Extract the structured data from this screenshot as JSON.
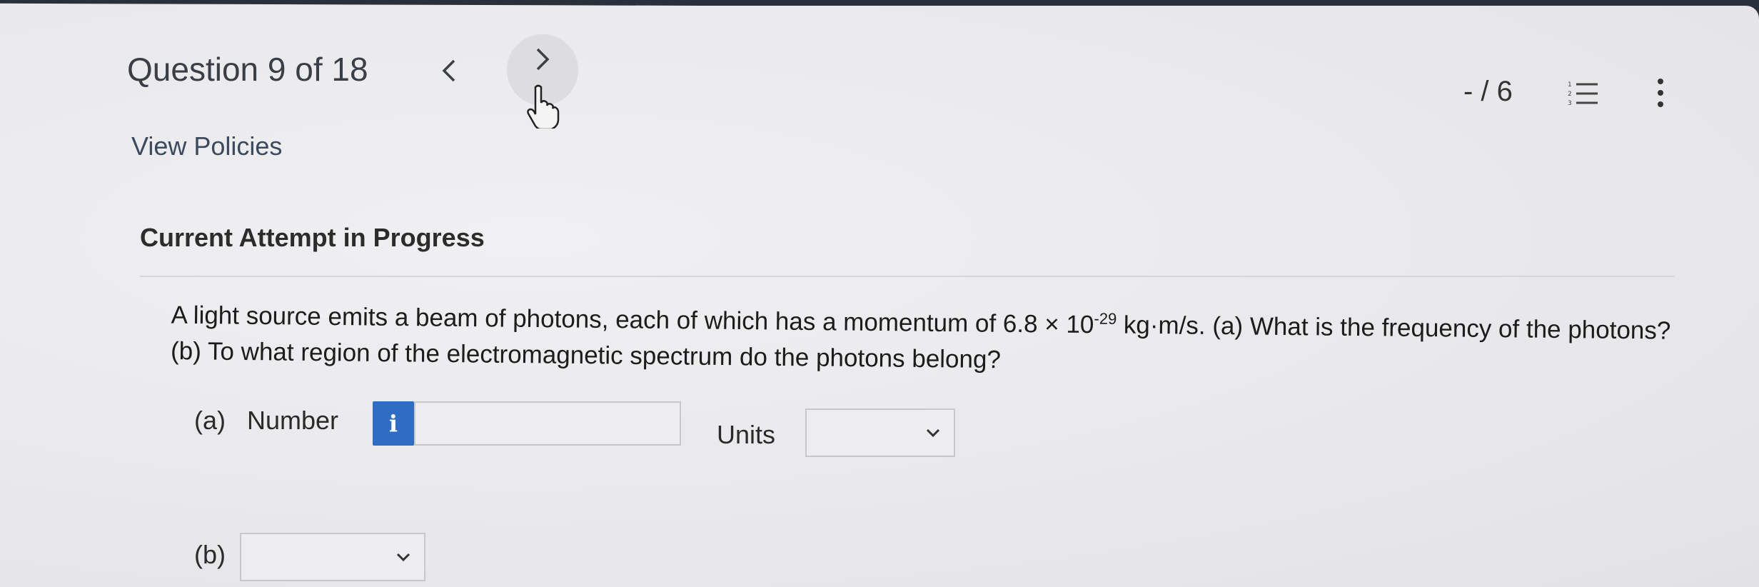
{
  "header": {
    "question_counter": "Question 9 of 18",
    "prev_icon": "chevron-left-icon",
    "next_icon": "chevron-right-icon",
    "score": "- / 6",
    "list_icon": "numbered-list-icon",
    "more_icon": "more-vertical-icon"
  },
  "links": {
    "view_policies": "View Policies"
  },
  "attempt": {
    "status": "Current Attempt in Progress"
  },
  "question": {
    "text_before": "A light source emits a beam of photons, each of which has a momentum of 6.8 × 10",
    "exponent": "-29",
    "text_after": " kg·m/s. (a) What is the frequency of the photons?",
    "line2": "(b) To what region of the electromagnetic spectrum do the photons belong?"
  },
  "part_a": {
    "label": "(a)",
    "number_label": "Number",
    "info_glyph": "i",
    "number_value": "",
    "units_label": "Units",
    "units_selected": ""
  },
  "part_b": {
    "label": "(b)",
    "selected": ""
  },
  "colors": {
    "info_button": "#2f6cc4",
    "link": "#3b4a5e"
  }
}
